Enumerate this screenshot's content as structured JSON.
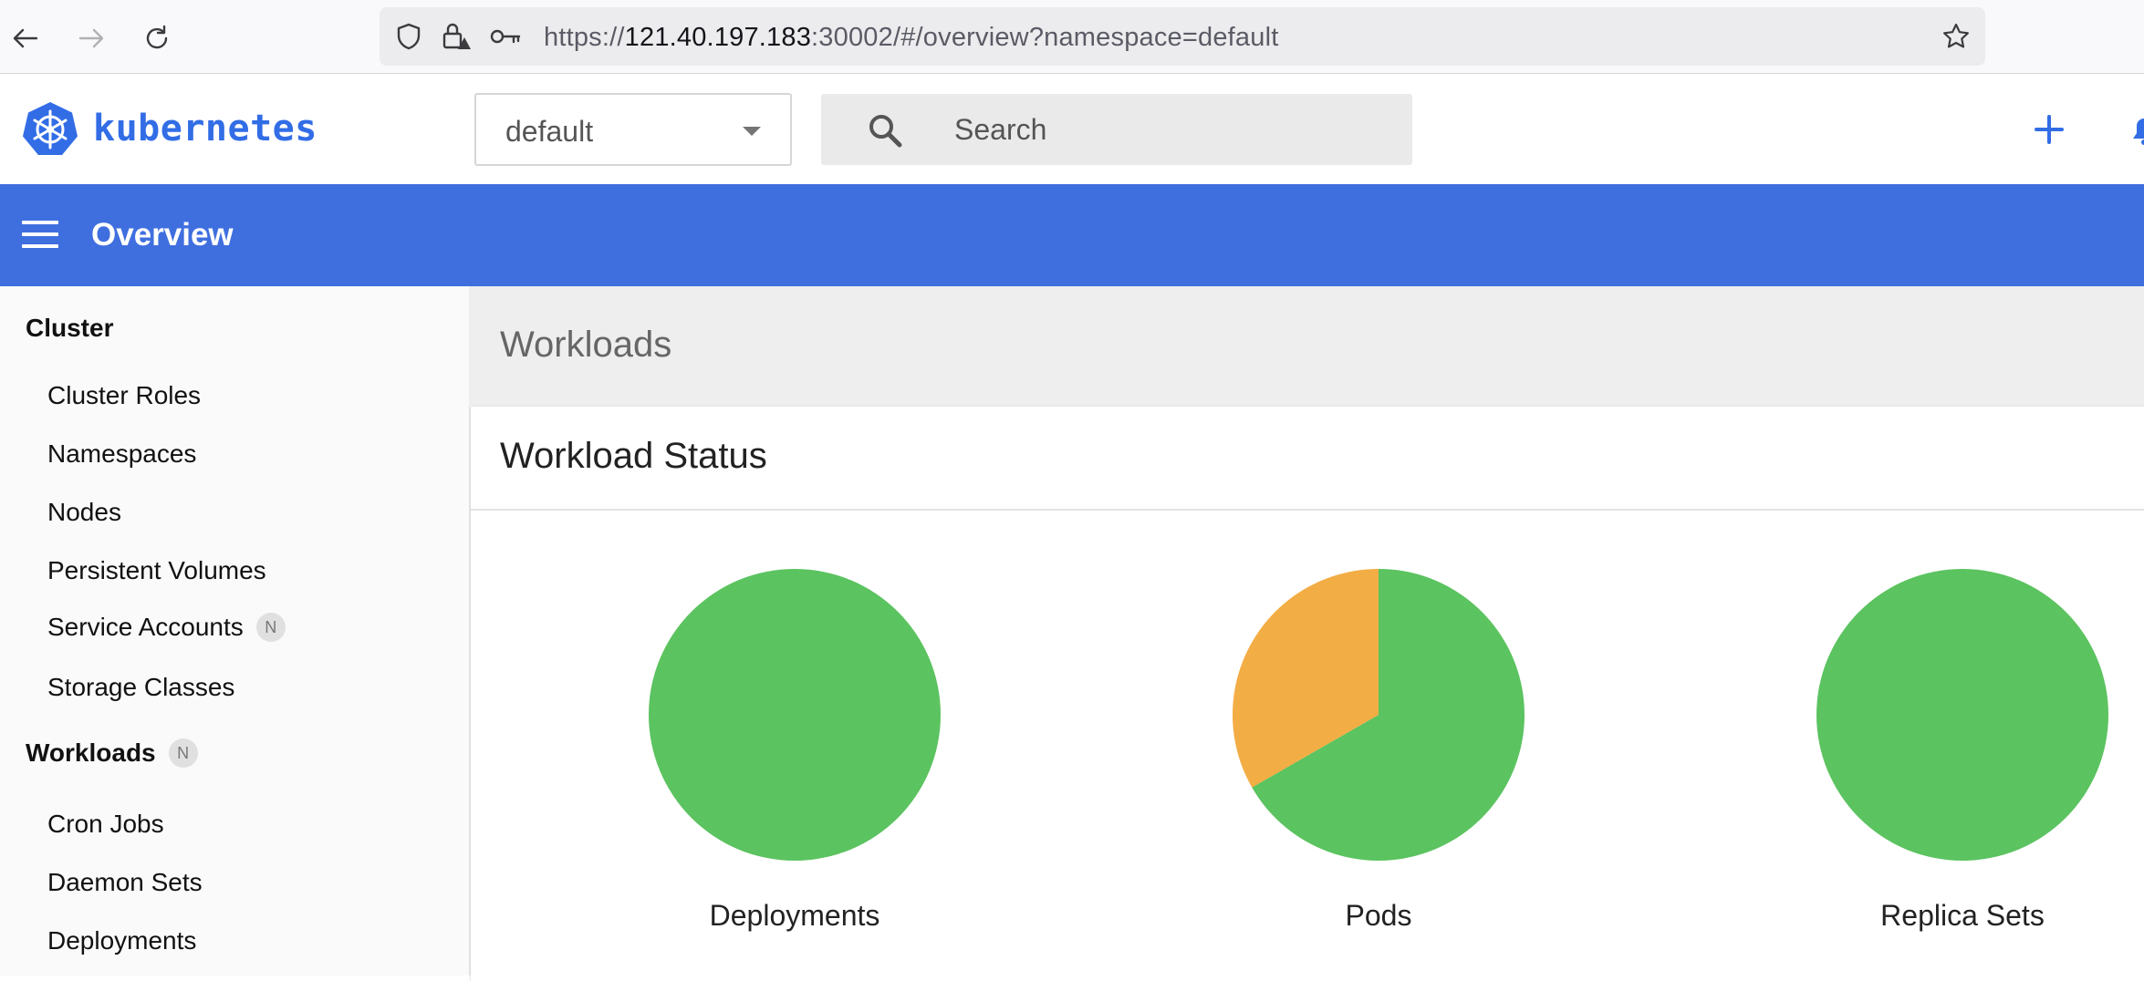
{
  "browser": {
    "url_prefix": "https://",
    "url_host": "121.40.197.183",
    "url_rest": ":30002/#/overview?namespace=default"
  },
  "header": {
    "logo_text": "kubernetes",
    "namespace_value": "default",
    "search_placeholder": "Search"
  },
  "toolbar": {
    "title": "Overview"
  },
  "sidebar": {
    "sections": [
      {
        "label": "Cluster",
        "badge": "",
        "items": [
          {
            "label": "Cluster Roles",
            "badge": ""
          },
          {
            "label": "Namespaces",
            "badge": ""
          },
          {
            "label": "Nodes",
            "badge": ""
          },
          {
            "label": "Persistent Volumes",
            "badge": ""
          },
          {
            "label": "Service Accounts",
            "badge": "N"
          },
          {
            "label": "Storage Classes",
            "badge": ""
          }
        ]
      },
      {
        "label": "Workloads",
        "badge": "N",
        "items": [
          {
            "label": "Cron Jobs",
            "badge": ""
          },
          {
            "label": "Daemon Sets",
            "badge": ""
          },
          {
            "label": "Deployments",
            "badge": ""
          }
        ]
      }
    ]
  },
  "main": {
    "section_title": "Workloads",
    "card_title": "Workload Status"
  },
  "colors": {
    "primary": "#3f6fdf",
    "running": "#5bc35f",
    "pending": "#f3ad45"
  },
  "chart_data": [
    {
      "type": "pie",
      "title": "Deployments",
      "slices": [
        {
          "color": "#5bc35f",
          "value": 1.0
        }
      ]
    },
    {
      "type": "pie",
      "title": "Pods",
      "slices": [
        {
          "color": "#5bc35f",
          "value": 0.667
        },
        {
          "color": "#f3ad45",
          "value": 0.333
        }
      ]
    },
    {
      "type": "pie",
      "title": "Replica Sets",
      "slices": [
        {
          "color": "#5bc35f",
          "value": 1.0
        }
      ]
    }
  ]
}
